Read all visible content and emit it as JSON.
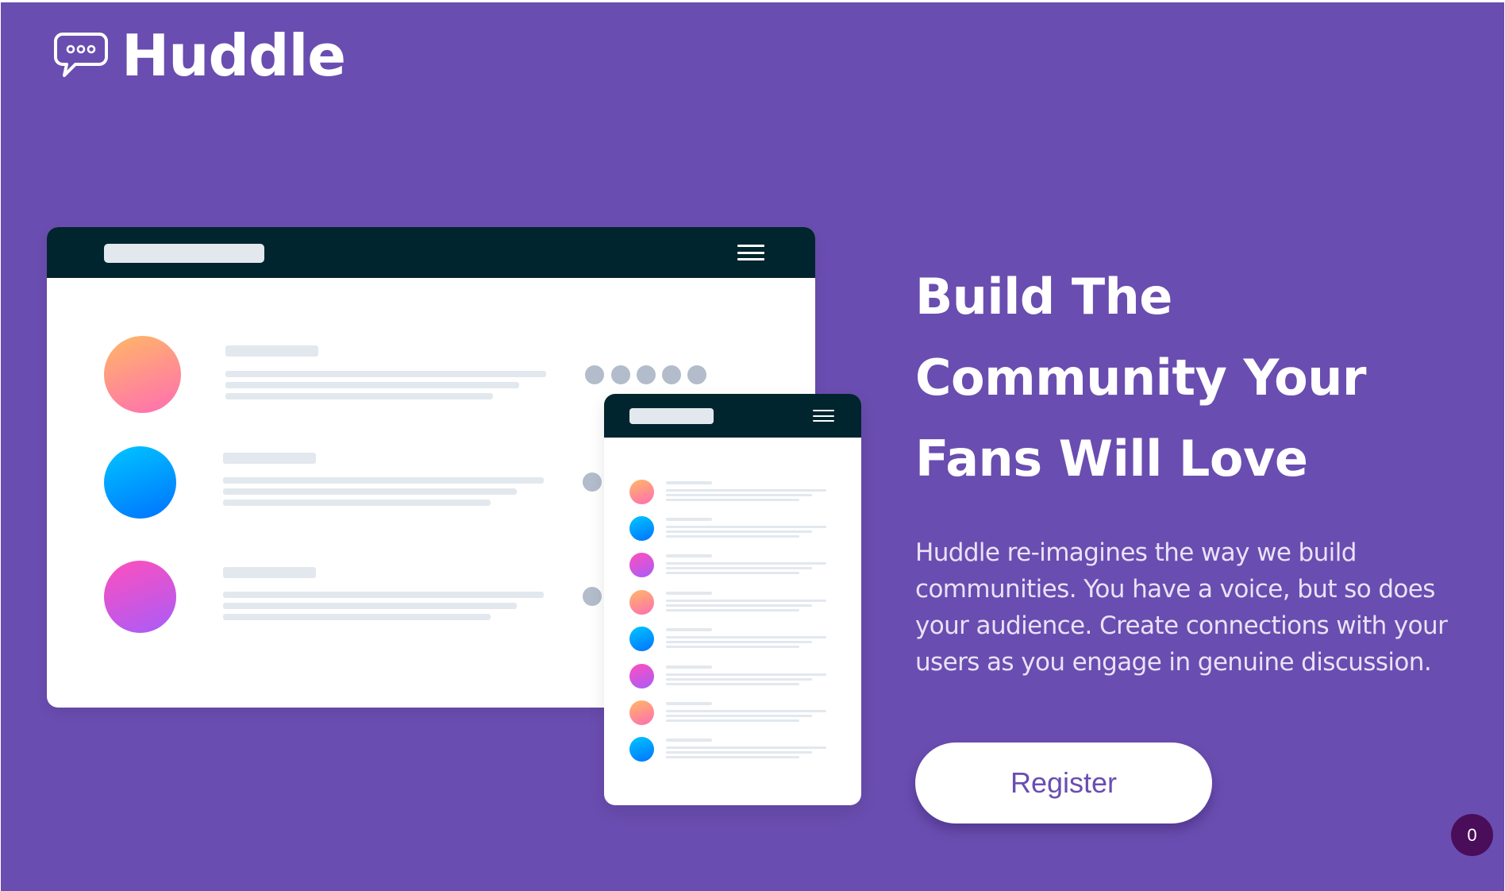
{
  "brand": {
    "name": "Huddle",
    "logo_icon": "chat-bubble-icon"
  },
  "hero": {
    "headline_lines": [
      "Build The",
      "Community Your",
      "Fans Will Love"
    ],
    "description": "Huddle re-imagines the way we build communities. You have a voice, but so does your audience. Create connections with your users as you engage in genuine discussion.",
    "cta_label": "Register"
  },
  "badge": {
    "count": "0"
  },
  "colors": {
    "background": "#6a4db0",
    "button_text": "#6a4db0",
    "mockup_bar": "#00252e",
    "badge": "#4a0d5a"
  },
  "illustration": {
    "icons": [
      "hamburger-menu-icon"
    ]
  }
}
